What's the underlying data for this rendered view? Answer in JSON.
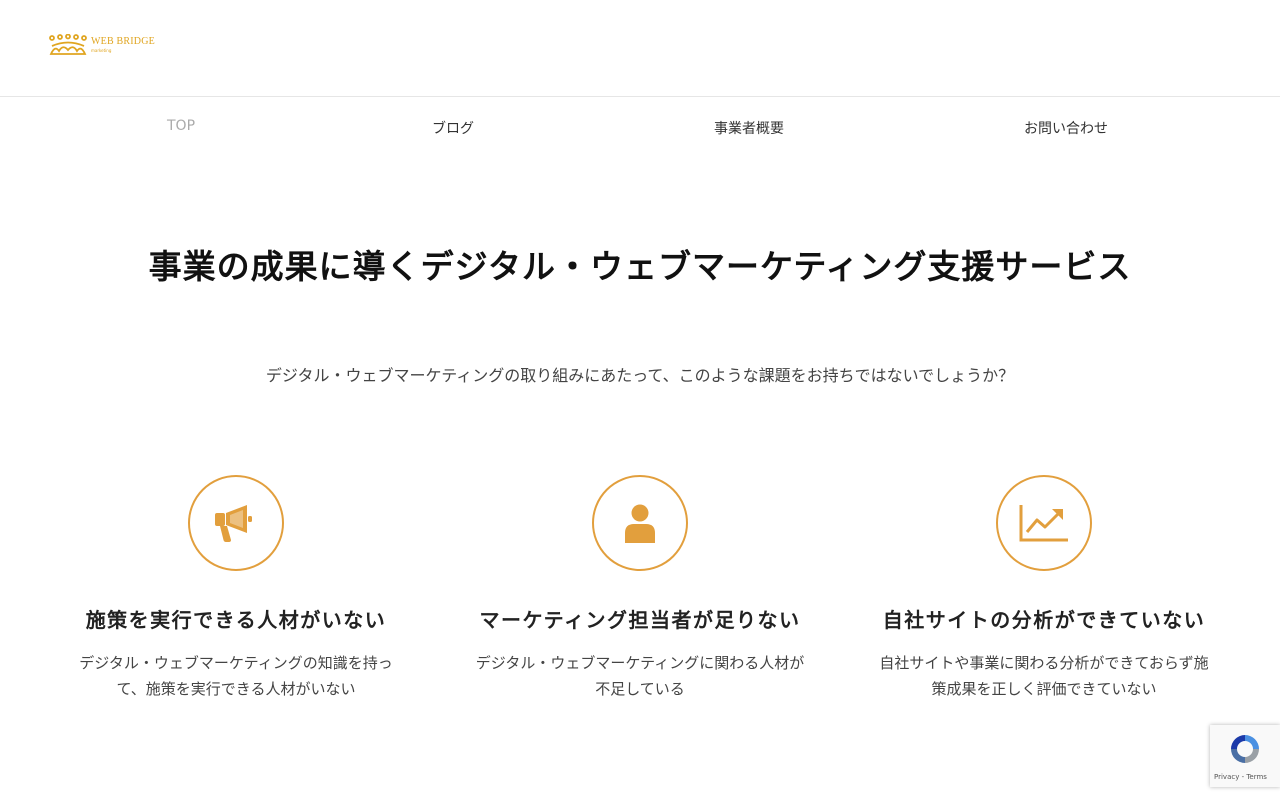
{
  "header": {
    "logo": {
      "name": "WEB BRIDGE",
      "sub": "marketing"
    }
  },
  "nav": {
    "items": [
      {
        "label": "TOP",
        "active": true
      },
      {
        "label": "ブログ",
        "active": false
      },
      {
        "label": "事業者概要",
        "active": false
      },
      {
        "label": "お問い合わせ",
        "active": false
      }
    ]
  },
  "hero": {
    "title": "事業の成果に導くデジタル・ウェブマーケティング支援サービス",
    "subtitle": "デジタル・ウェブマーケティングの取り組みにあたって、このような課題をお持ちではないでしょうか？"
  },
  "features": [
    {
      "icon": "megaphone-icon",
      "title": "施策を実行できる人材がいない",
      "description": "デジタル・ウェブマーケティングの知識を持って、施策を実行できる人材がいない"
    },
    {
      "icon": "person-icon",
      "title": "マーケティング担当者が足りない",
      "description": "デジタル・ウェブマーケティングに関わる人材が不足している"
    },
    {
      "icon": "chart-up-icon",
      "title": "自社サイトの分析ができていない",
      "description": "自社サイトや事業に関わる分析ができておらず施策成果を正しく評価できていない"
    }
  ],
  "recaptcha": {
    "text": "Privacy - Terms"
  },
  "colors": {
    "accent": "#e29f3d",
    "logo": "#e0a520",
    "nav_active": "#aaaaaa"
  }
}
